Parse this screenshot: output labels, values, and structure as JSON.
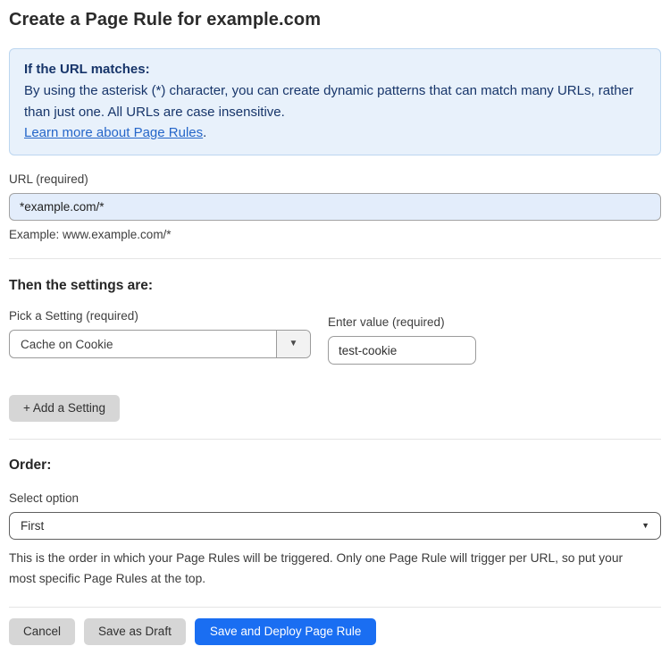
{
  "page": {
    "title": "Create a Page Rule for example.com"
  },
  "info_box": {
    "heading": "If the URL matches:",
    "body": "By using the asterisk (*) character, you can create dynamic patterns that can match many URLs, rather than just one. All URLs are case insensitive.",
    "link": "Learn more about Page Rules",
    "link_suffix": "."
  },
  "url_field": {
    "label": "URL (required)",
    "value": "*example.com/*",
    "helper": "Example: www.example.com/*"
  },
  "settings": {
    "heading": "Then the settings are:",
    "setting_label": "Pick a Setting (required)",
    "setting_value": "Cache on Cookie",
    "value_label": "Enter value (required)",
    "value_value": "test-cookie",
    "add_button": "+ Add a Setting"
  },
  "order": {
    "heading": "Order:",
    "label": "Select option",
    "value": "First",
    "helper": "This is the order in which your Page Rules will be triggered. Only one Page Rule will trigger per URL, so put your most specific Page Rules at the top."
  },
  "footer": {
    "cancel": "Cancel",
    "save_draft": "Save as Draft",
    "save_deploy": "Save and Deploy Page Rule"
  },
  "colors": {
    "accent_blue": "#1a6ef2",
    "info_bg": "#e8f1fb",
    "info_border": "#bcd6f0",
    "navy_text": "#17356a",
    "link_blue": "#2566c9",
    "input_autofill_bg": "#e3edfb"
  }
}
